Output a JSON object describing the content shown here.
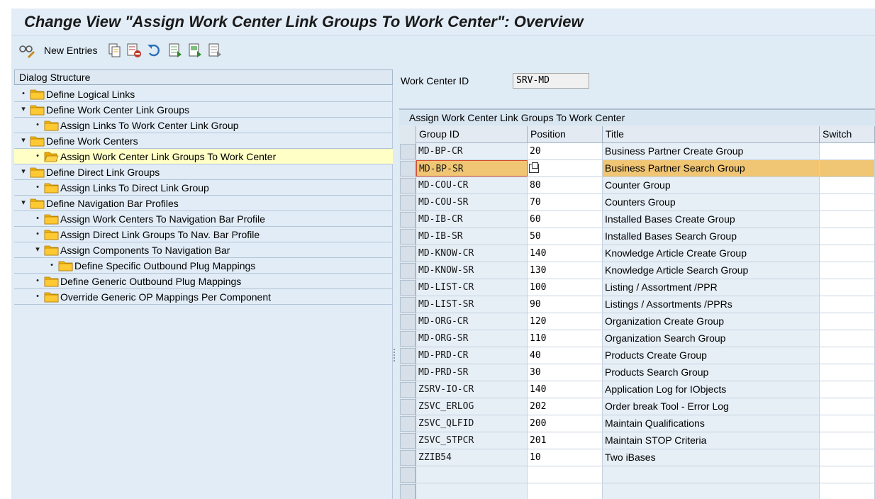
{
  "window": {
    "title": "Change View \"Assign Work Center Link Groups To Work Center\": Overview"
  },
  "toolbar": {
    "new_entries_label": "New Entries",
    "icons": [
      "glasses-pencil-icon",
      "copy-icon",
      "delete-icon",
      "undo-icon",
      "select-all-icon",
      "select-block-icon",
      "deselect-all-icon"
    ]
  },
  "dialog_structure": {
    "header": "Dialog Structure",
    "items": [
      {
        "label": "Define Logical Links",
        "level": 0,
        "marker": "•"
      },
      {
        "label": "Define Work Center Link Groups",
        "level": 0,
        "marker": "▾"
      },
      {
        "label": "Assign Links To Work Center Link Group",
        "level": 1,
        "marker": "•"
      },
      {
        "label": "Define Work Centers",
        "level": 0,
        "marker": "▾"
      },
      {
        "label": "Assign Work Center Link Groups To Work Center",
        "level": 1,
        "marker": "•",
        "selected": true
      },
      {
        "label": "Define Direct Link Groups",
        "level": 0,
        "marker": "▾"
      },
      {
        "label": "Assign Links To Direct Link Group",
        "level": 1,
        "marker": "•"
      },
      {
        "label": "Define Navigation Bar Profiles",
        "level": 0,
        "marker": "▾"
      },
      {
        "label": "Assign Work Centers To Navigation Bar Profile",
        "level": 1,
        "marker": "•"
      },
      {
        "label": "Assign Direct Link Groups To Nav. Bar Profile",
        "level": 1,
        "marker": "•"
      },
      {
        "label": "Assign Components To Navigation Bar",
        "level": 1,
        "marker": "▾"
      },
      {
        "label": "Define Specific Outbound Plug Mappings",
        "level": 2,
        "marker": "•"
      },
      {
        "label": "Define Generic Outbound Plug Mappings",
        "level": 1,
        "marker": "•"
      },
      {
        "label": "Override Generic OP Mappings Per Component",
        "level": 1,
        "marker": "•"
      }
    ]
  },
  "work_center": {
    "label": "Work Center ID",
    "value": "SRV-MD"
  },
  "table": {
    "title": "Assign Work Center Link Groups To Work Center",
    "columns": [
      "Group ID",
      "Position",
      "Title",
      "Switch"
    ],
    "rows": [
      {
        "group_id": "MD-BP-CR",
        "position": "20",
        "title": "Business Partner Create Group",
        "switch": ""
      },
      {
        "group_id": "MD-BP-SR",
        "position": "",
        "title": "Business Partner Search Group",
        "switch": "",
        "highlighted": true
      },
      {
        "group_id": "MD-COU-CR",
        "position": "80",
        "title": "Counter Group",
        "switch": ""
      },
      {
        "group_id": "MD-COU-SR",
        "position": "70",
        "title": "Counters Group",
        "switch": ""
      },
      {
        "group_id": "MD-IB-CR",
        "position": "60",
        "title": "Installed Bases Create Group",
        "switch": ""
      },
      {
        "group_id": "MD-IB-SR",
        "position": "50",
        "title": "Installed Bases Search Group",
        "switch": ""
      },
      {
        "group_id": "MD-KNOW-CR",
        "position": "140",
        "title": "Knowledge Article Create Group",
        "switch": ""
      },
      {
        "group_id": "MD-KNOW-SR",
        "position": "130",
        "title": "Knowledge Article Search Group",
        "switch": ""
      },
      {
        "group_id": "MD-LIST-CR",
        "position": "100",
        "title": "Listing / Assortment /PPR",
        "switch": ""
      },
      {
        "group_id": "MD-LIST-SR",
        "position": "90",
        "title": "Listings / Assortments /PPRs",
        "switch": ""
      },
      {
        "group_id": "MD-ORG-CR",
        "position": "120",
        "title": "Organization Create Group",
        "switch": ""
      },
      {
        "group_id": "MD-ORG-SR",
        "position": "110",
        "title": "Organization Search Group",
        "switch": ""
      },
      {
        "group_id": "MD-PRD-CR",
        "position": "40",
        "title": "Products Create Group",
        "switch": ""
      },
      {
        "group_id": "MD-PRD-SR",
        "position": "30",
        "title": "Products Search Group",
        "switch": ""
      },
      {
        "group_id": "ZSRV-IO-CR",
        "position": "140",
        "title": "Application Log for IObjects",
        "switch": ""
      },
      {
        "group_id": "ZSVC_ERLOG",
        "position": "202",
        "title": "Order break Tool - Error Log",
        "switch": ""
      },
      {
        "group_id": "ZSVC_QLFID",
        "position": "200",
        "title": "Maintain Qualifications",
        "switch": ""
      },
      {
        "group_id": "ZSVC_STPCR",
        "position": "201",
        "title": "Maintain STOP Criteria",
        "switch": ""
      },
      {
        "group_id": "ZZIB54",
        "position": "10",
        "title": "Two iBases",
        "switch": ""
      }
    ],
    "empty_rows": 2
  },
  "colors": {
    "accent_folder": "#f5b800",
    "highlight_row": "#f0c674",
    "selected_tree_row": "#ffffc6"
  }
}
